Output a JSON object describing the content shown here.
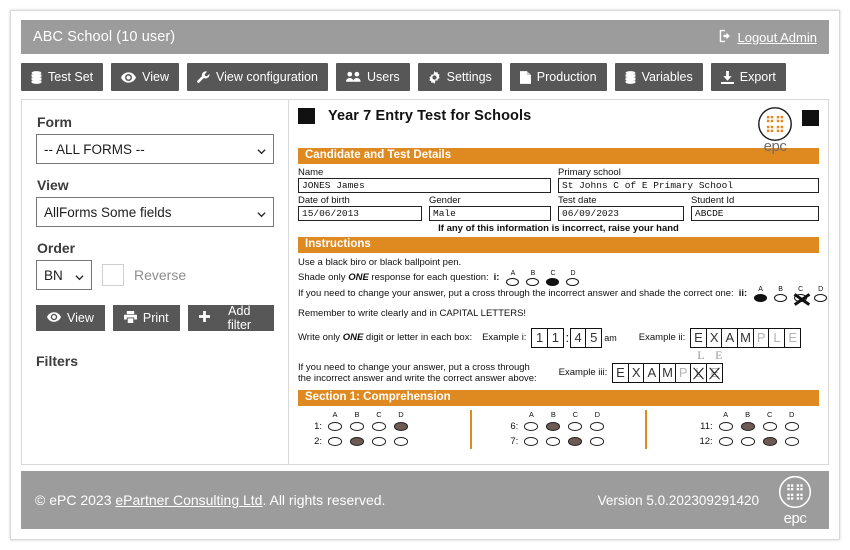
{
  "header": {
    "title": "ABC School (10 user)",
    "logout_label": "Logout Admin",
    "logout_icon": "sign-out-icon",
    "bg_color": "#9c9c9c"
  },
  "toolbar": {
    "bg_color": "#575757",
    "buttons": [
      {
        "label": "Test Set",
        "icon": "database-icon"
      },
      {
        "label": "View",
        "icon": "eye-icon"
      },
      {
        "label": "View configuration",
        "icon": "wrench-icon"
      },
      {
        "label": "Users",
        "icon": "users-icon"
      },
      {
        "label": "Settings",
        "icon": "gear-icon"
      },
      {
        "label": "Production",
        "icon": "file-icon"
      },
      {
        "label": "Variables",
        "icon": "database-icon"
      },
      {
        "label": "Export",
        "icon": "download-icon"
      }
    ]
  },
  "sidebar": {
    "form_label": "Form",
    "form_value": "-- ALL FORMS --",
    "view_label": "View",
    "view_value": "AllForms Some fields",
    "order_label": "Order",
    "order_value": "BN",
    "reverse_label": "Reverse",
    "buttons": [
      {
        "label": "View",
        "icon": "eye-icon"
      },
      {
        "label": "Print",
        "icon": "printer-icon"
      },
      {
        "label": "Add filter",
        "icon": "plus-icon"
      }
    ],
    "filters_label": "Filters"
  },
  "document": {
    "title": "Year 7 Entry Test for Schools",
    "logo_word": "epc",
    "sections": {
      "candidate": "Candidate and Test Details",
      "instructions": "Instructions",
      "section1": "Section 1: Comprehension"
    },
    "fields": {
      "name_label": "Name",
      "name_value": "JONES James",
      "school_label": "Primary school",
      "school_value": "St Johns C of E Primary School",
      "dob_label": "Date of birth",
      "dob_value": "15/06/2013",
      "gender_label": "Gender",
      "gender_value": "Male",
      "testdate_label": "Test date",
      "testdate_value": "06/09/2023",
      "studentid_label": "Student Id",
      "studentid_value": "ABCDE"
    },
    "notice": "If any of this information is incorrect, raise your hand",
    "instructions": {
      "line1": "Use a black biro or black ballpoint pen.",
      "line2_a": "Shade only ",
      "line2_em": "ONE",
      "line2_b": " response for each question:",
      "line2_tag": "i:",
      "line3": "If you need to change your answer, put a cross through the incorrect answer and shade the correct one:",
      "line3_tag": "ii:",
      "line4": "Remember to write clearly and in CAPITAL LETTERS!",
      "line5_a": "Write only ",
      "line5_em": "ONE",
      "line5_b": " digit or letter in each box:",
      "example_i_label": "Example i:",
      "example_i_boxes": [
        "1",
        "1",
        ":",
        "4",
        "5"
      ],
      "example_i_suffix": "am",
      "example_ii_label": "Example ii:",
      "example_ii_boxes": [
        "E",
        "X",
        "A",
        "M",
        "P",
        "L",
        "E"
      ],
      "example_ii_faint_from": 4,
      "line6_a": "If you need to change your answer, put a cross through",
      "line6_b": "the incorrect answer and write the correct answer above:",
      "example_iii_label": "Example iii:",
      "example_iii_boxes": [
        "E",
        "X",
        "A",
        "M",
        "P",
        "L",
        "E"
      ],
      "example_iii_crossed": [
        5,
        6
      ],
      "example_iii_above": "L E",
      "option_letters": [
        "A",
        "B",
        "C",
        "D"
      ],
      "example_i_bubbles": [
        "open",
        "open",
        "filled",
        "open"
      ],
      "example_ii_bubbles": [
        "filled",
        "open",
        "crossed",
        "open"
      ]
    },
    "answers": {
      "columns": [
        {
          "headers": [
            "A",
            "B",
            "C",
            "D"
          ],
          "rows": [
            {
              "number": "1:",
              "marks": [
                "open",
                "open",
                "open",
                "shaded"
              ]
            },
            {
              "number": "2:",
              "marks": [
                "open",
                "shaded",
                "open",
                "open"
              ]
            }
          ]
        },
        {
          "headers": [
            "A",
            "B",
            "C",
            "D"
          ],
          "rows": [
            {
              "number": "6:",
              "marks": [
                "open",
                "shaded",
                "open",
                "open"
              ]
            },
            {
              "number": "7:",
              "marks": [
                "open",
                "open",
                "shaded",
                "open"
              ]
            }
          ]
        },
        {
          "headers": [
            "A",
            "B",
            "C",
            "D"
          ],
          "rows": [
            {
              "number": "11:",
              "marks": [
                "open",
                "shaded",
                "open",
                "open"
              ]
            },
            {
              "number": "12:",
              "marks": [
                "open",
                "open",
                "shaded",
                "open"
              ]
            }
          ]
        }
      ]
    },
    "accent_color": "#df8a20"
  },
  "footer": {
    "copyright_prefix": "© ePC 2023 ",
    "company_link": "ePartner Consulting Ltd",
    "copyright_suffix": ". All rights reserved.",
    "version": "Version 5.0.202309291420",
    "logo_word": "epc",
    "bg_color": "#9c9c9c"
  }
}
